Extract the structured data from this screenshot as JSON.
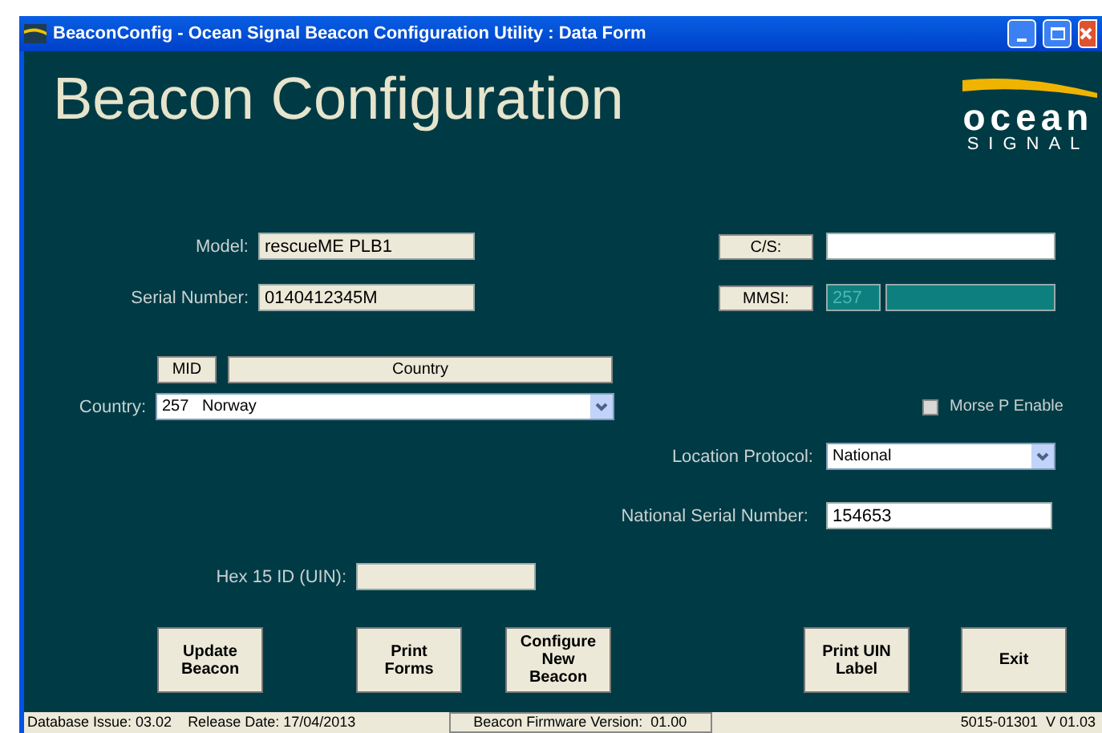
{
  "window": {
    "title": "BeaconConfig - Ocean Signal Beacon Configuration Utility : Data Form"
  },
  "heading": "Beacon Configuration",
  "logo": {
    "line1": "ocean",
    "line2": "SIGNAL"
  },
  "model": {
    "label": "Model:",
    "value": "rescueME PLB1"
  },
  "serial_number": {
    "label": "Serial Number:",
    "value": "0140412345M"
  },
  "cs": {
    "button": "C/S:"
  },
  "mmsi": {
    "button": "MMSI:",
    "prefix": "257"
  },
  "sort_buttons": [
    "MID",
    "Country"
  ],
  "country": {
    "label": "Country:",
    "value": "257   Norway"
  },
  "morse": {
    "label": "Morse P Enable",
    "checked": false
  },
  "location_protocol": {
    "label": "Location Protocol:",
    "value": "National"
  },
  "national_serial": {
    "label": "National Serial Number:",
    "value": "154653"
  },
  "hex_id": {
    "label": "Hex 15 ID (UIN):"
  },
  "actions": [
    "Update Beacon",
    "Print Forms",
    "Configure New Beacon",
    "Print UIN Label",
    "Exit"
  ],
  "status_bar": {
    "database": "Database Issue: 03.02",
    "release": "Release Date: 17/04/2013",
    "firmware": "Beacon Firmware Version:  01.00",
    "version": "5015-01301  V 01.03"
  }
}
